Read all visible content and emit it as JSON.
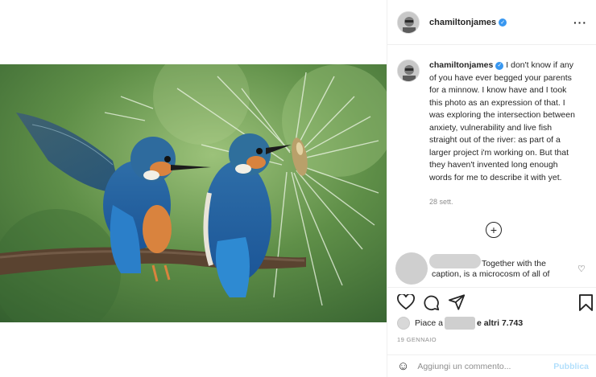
{
  "post": {
    "username": "chamiltonjames",
    "caption": "I don't know if any of you have ever begged your parents for a minnow. I know have and I took this photo as an expression of that. I was exploring the intersection between anxiety, vulnerability and live fish straight out of the river: as part of a larger project i'm working on. But that they haven't invented long enough words for me to describe it with yet.",
    "time_ago": "28 sett.",
    "comment_text": "Together with the caption, is a microcosm of all of",
    "likes_prefix": "Piace a",
    "likes_suffix": "e altri 7.743",
    "date": "19 GENNAIO"
  },
  "composer": {
    "placeholder": "Aggiungi un commento...",
    "publish_label": "Pubblica"
  },
  "icons": {
    "more": "more-options-icon",
    "verified": "verified-badge-icon",
    "load_more": "plus-circle-icon",
    "like": "heart-icon",
    "comment": "comment-icon",
    "share": "paper-plane-icon",
    "save": "bookmark-icon",
    "emoji": "emoji-icon"
  },
  "colors": {
    "verified": "#3897f0",
    "publish_disabled": "#b2dffc",
    "secondary_text": "#8e8e8e"
  }
}
